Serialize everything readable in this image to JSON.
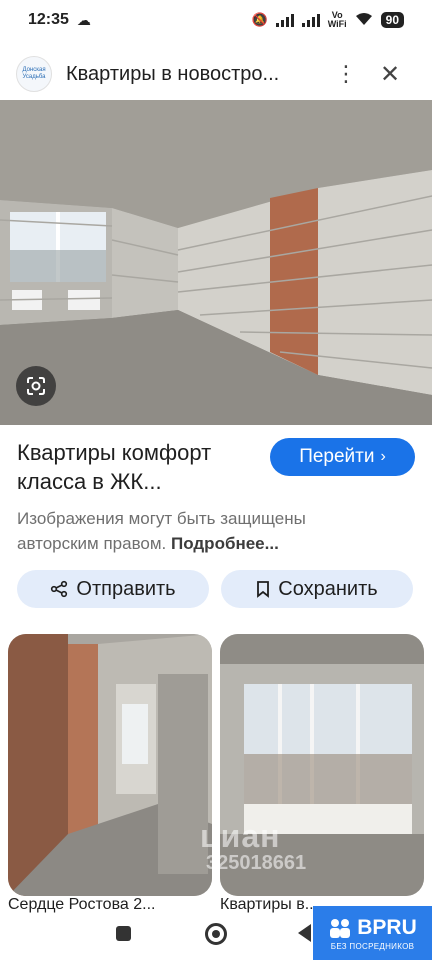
{
  "status_bar": {
    "time": "12:35",
    "vowifi_top": "Vo",
    "vowifi_bottom": "WiFi",
    "battery": "90"
  },
  "header": {
    "logo_text": "Донская Усадьба",
    "title": "Квартиры в новостро..."
  },
  "result": {
    "title": "Квартиры комфорт класса в ЖК...",
    "visit_label": "Перейти",
    "copyright_text": "Изображения могут быть защищены авторским правом.",
    "copyright_more": "Подробнее..."
  },
  "actions": {
    "share_label": "Отправить",
    "save_label": "Сохранить"
  },
  "related": [
    {
      "caption": "Сердце Ростова 2..."
    },
    {
      "caption": "Квартиры в..."
    }
  ],
  "watermark": {
    "text": "циан",
    "id": "325018661"
  },
  "badge": {
    "name": "BPRU",
    "subtitle": "БЕЗ ПОСРЕДНИКОВ"
  },
  "colors": {
    "accent": "#1a73e8",
    "chip": "#e3ecfa",
    "badge": "#2b7de9"
  }
}
